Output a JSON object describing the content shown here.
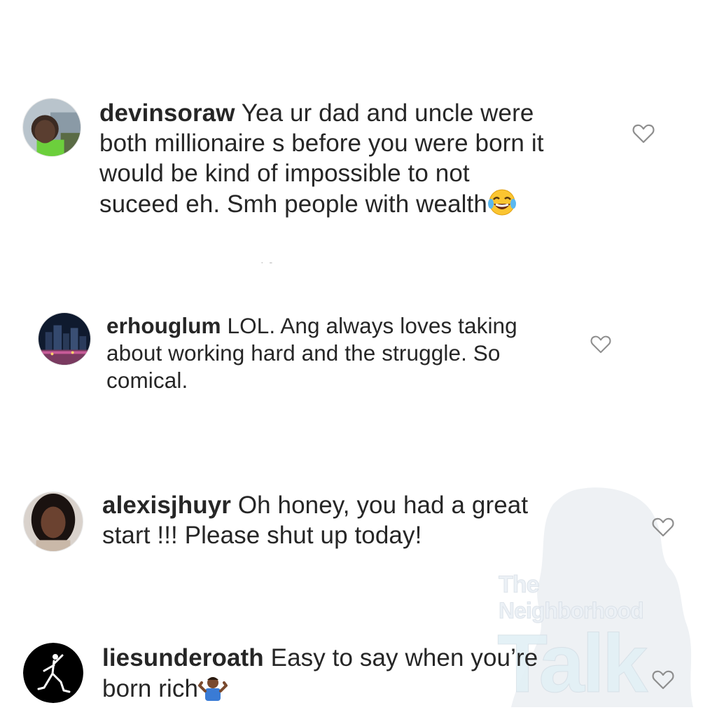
{
  "comments": [
    {
      "username": "devinsoraw",
      "lines": [
        "Yea ur dad and uncle were",
        "both millionaire s before you were born it",
        "would be kind of impossible to not",
        "suceed eh. Smh people with wealth"
      ],
      "emoji": "face-with-tears-of-joy",
      "avatar": "person-outdoor-photo"
    },
    {
      "username": "erhouglum",
      "lines": [
        "LOL. Ang always loves taking",
        "about working hard and the struggle. So",
        "comical."
      ],
      "avatar": "city-night-skyline"
    },
    {
      "username": "alexisjhuyr",
      "lines": [
        "Oh honey, you had a great",
        "start !!! Please shut up today!"
      ],
      "avatar": "woman-portrait"
    },
    {
      "username": "liesunderoath",
      "lines": [
        "Easy to say when you’re",
        "born rich"
      ],
      "emoji": "person-shrugging",
      "avatar": "jumpman-logo"
    }
  ],
  "like_icon": "heart-outline-icon",
  "watermark": {
    "line1": "The",
    "line2": "Neighborhood",
    "line3": "Talk"
  },
  "colors": {
    "text": "#262626",
    "heart_stroke": "#8e8e8e",
    "background": "#ffffff"
  }
}
